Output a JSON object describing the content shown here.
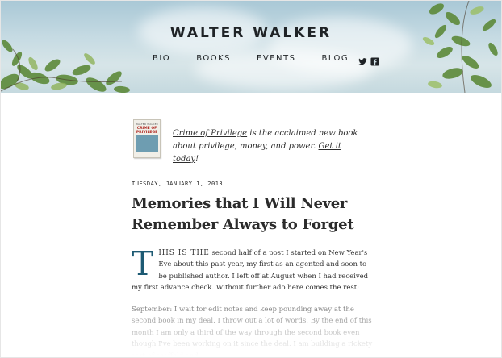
{
  "site": {
    "title": "WALTER WALKER"
  },
  "nav": {
    "items": [
      {
        "label": "BIO"
      },
      {
        "label": "BOOKS"
      },
      {
        "label": "EVENTS"
      },
      {
        "label": "BLOG"
      }
    ],
    "social": [
      "twitter-icon",
      "facebook-icon"
    ]
  },
  "promo": {
    "book_author": "WALTER WALKER",
    "book_title": "CRIME OF PRIVILEGE",
    "link_title": "Crime of Privilege",
    "text_mid": " is the acclaimed new book about privilege, money, and power. ",
    "link_cta": "Get it today",
    "text_end": "!"
  },
  "post": {
    "date": "TUESDAY, JANUARY 1, 2013",
    "title": "Memories that I Will Never Remember Always to Forget",
    "dropcap": "T",
    "lead_smallcaps": "HIS IS THE",
    "para1_rest": " second half of a post I started on New Year's Eve about this past year, my first as an agented and soon to be published author. I left off at August when I had received my first advance check. Without further ado here comes the rest:",
    "para2": "September: I wait for edit notes and keep pounding away at the second book in my deal. I throw out a lot of words. By the end of this month I am only a third of the way through the second book even though I've been working on it since the deal. I am building a rickety sort of scaffold and"
  },
  "colors": {
    "accent": "#1d5a73",
    "text": "#2b2b2b"
  }
}
